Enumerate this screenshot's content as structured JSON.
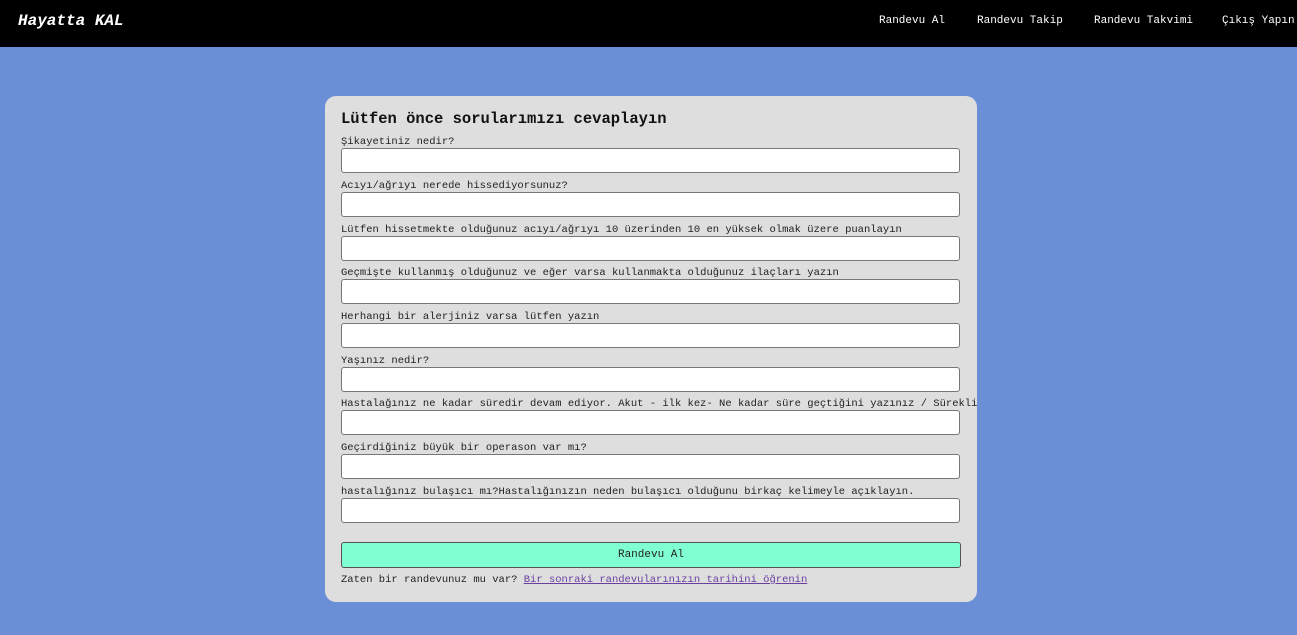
{
  "header": {
    "brand": "Hayatta KAL",
    "nav": [
      {
        "label": "Randevu Al"
      },
      {
        "label": "Randevu Takip"
      },
      {
        "label": "Randevu Takvimi"
      },
      {
        "label": "Çıkış Yapın"
      }
    ]
  },
  "form": {
    "title": "Lütfen önce sorularımızı cevaplayın",
    "questions": [
      {
        "label": "Şikayetiniz nedir?",
        "value": ""
      },
      {
        "label": "Acıyı/ağrıyı nerede hissediyorsunuz?",
        "value": ""
      },
      {
        "label": "Lütfen hissetmekte olduğunuz acıyı/ağrıyı 10 üzerinden 10 en yüksek olmak üzere puanlayın",
        "value": ""
      },
      {
        "label": "Geçmişte kullanmış olduğunuz ve eğer varsa kullanmakta olduğunuz ilaçları yazın",
        "value": ""
      },
      {
        "label": "Herhangi bir alerjiniz varsa lütfen yazın",
        "value": ""
      },
      {
        "label": "Yaşınız nedir?",
        "value": ""
      },
      {
        "label": "Hastalağınız ne kadar süredir devam ediyor. Akut - ilk kez- Ne kadar süre geçtiğini yazınız / Sürekli",
        "value": ""
      },
      {
        "label": "Geçirdiğiniz büyük bir operason var mı?",
        "value": ""
      },
      {
        "label": "hastalığınız bulaşıcı mı?Hastalığınızın neden bulaşıcı olduğunu birkaç kelimeyle açıklayın.",
        "value": ""
      }
    ],
    "submit_label": "Randevu Al",
    "footer_text": "Zaten bir randevunuz mu var? ",
    "footer_link": "Bir sonraki randevularınızın tarihini öğrenin"
  },
  "colors": {
    "background": "#6b8fd6",
    "header": "#000000",
    "card": "#dedede",
    "button": "#80ffd0",
    "link": "#6a3fa0"
  }
}
